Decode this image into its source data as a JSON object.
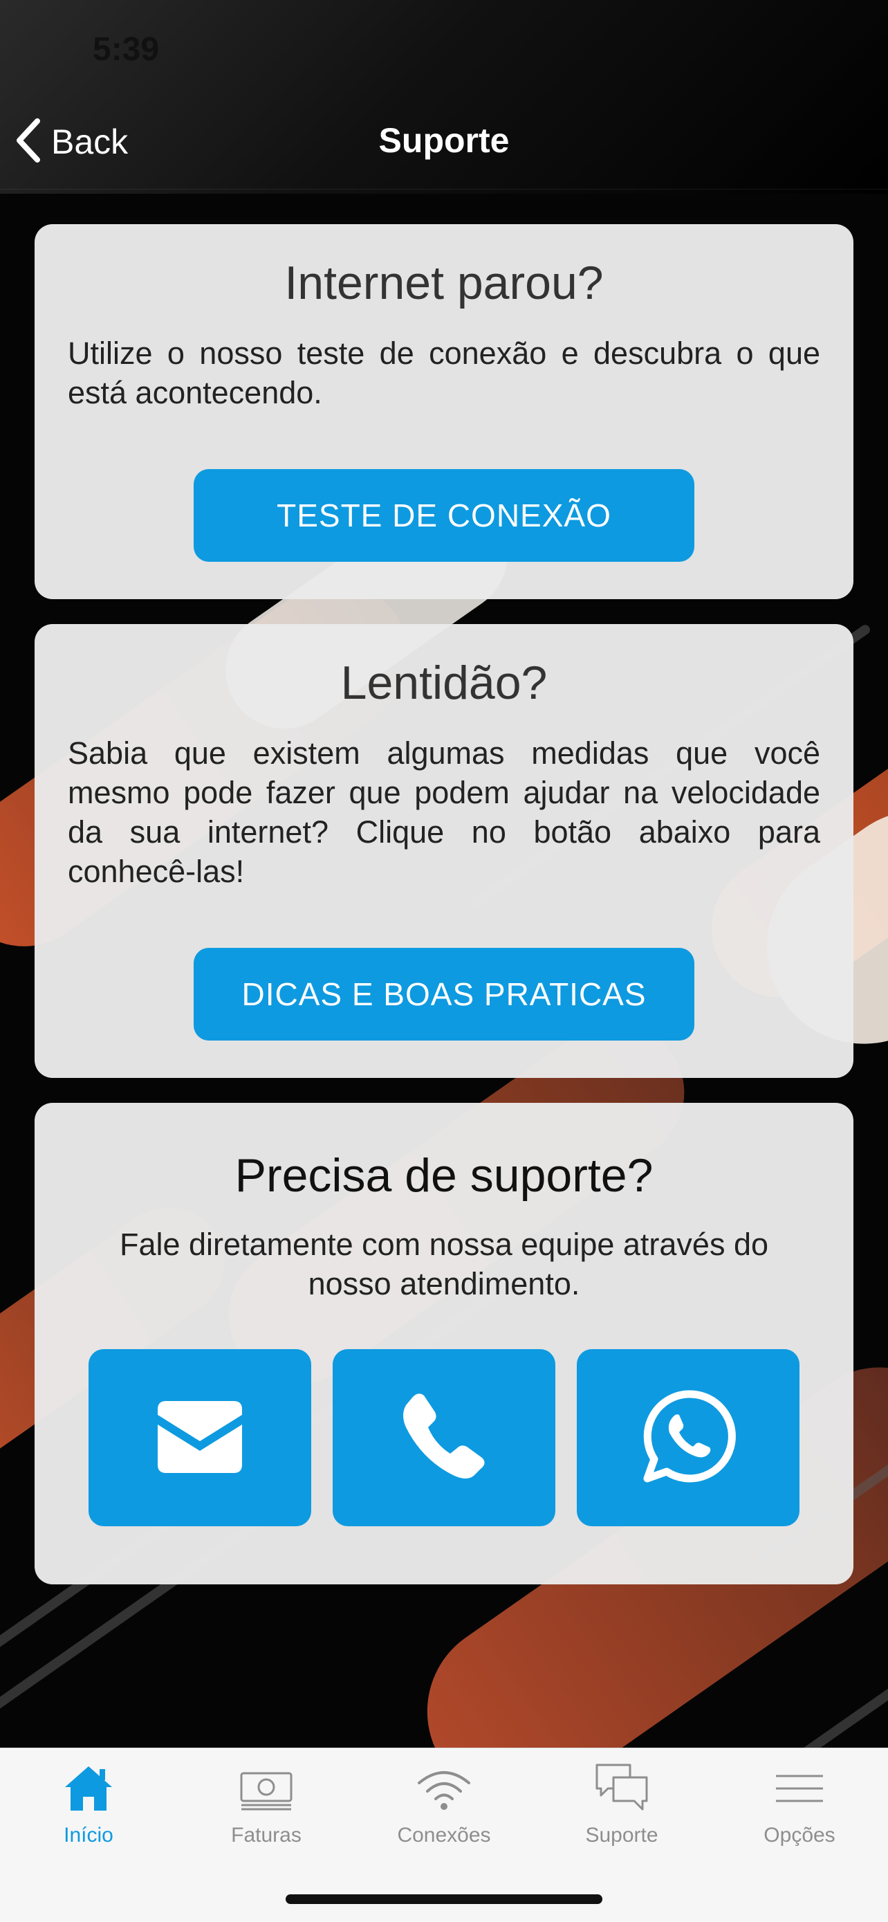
{
  "status_bar": {
    "time": "5:39"
  },
  "nav": {
    "back_label": "Back",
    "title": "Suporte"
  },
  "cards": {
    "internet": {
      "title": "Internet parou?",
      "text": "Utilize o nosso teste de conexão e descubra o que está acontecendo.",
      "button": "TESTE DE CONEXÃO"
    },
    "slowness": {
      "title": "Lentidão?",
      "text": "Sabia que existem algumas medidas que você mesmo pode fazer que podem ajudar na velocidade da sua internet? Clique no botão abaixo para conhecê-las!",
      "button": "DICAS E BOAS PRATICAS"
    },
    "support": {
      "title": "Precisa de suporte?",
      "text": "Fale diretamente com nossa equipe através do nosso atendimento.",
      "contacts": [
        {
          "icon": "envelope-icon"
        },
        {
          "icon": "phone-icon"
        },
        {
          "icon": "whatsapp-icon"
        }
      ]
    }
  },
  "tabbar": {
    "items": [
      {
        "label": "Início",
        "icon": "home-icon",
        "active": true
      },
      {
        "label": "Faturas",
        "icon": "banknote-icon",
        "active": false
      },
      {
        "label": "Conexões",
        "icon": "wifi-icon",
        "active": false
      },
      {
        "label": "Suporte",
        "icon": "chat-bubbles-icon",
        "active": false
      },
      {
        "label": "Opções",
        "icon": "menu-icon",
        "active": false
      }
    ]
  },
  "colors": {
    "accent": "#0e9ae0",
    "card_bg": "#eaeaea",
    "tab_inactive": "#8e8e8e",
    "background": "#050505"
  }
}
